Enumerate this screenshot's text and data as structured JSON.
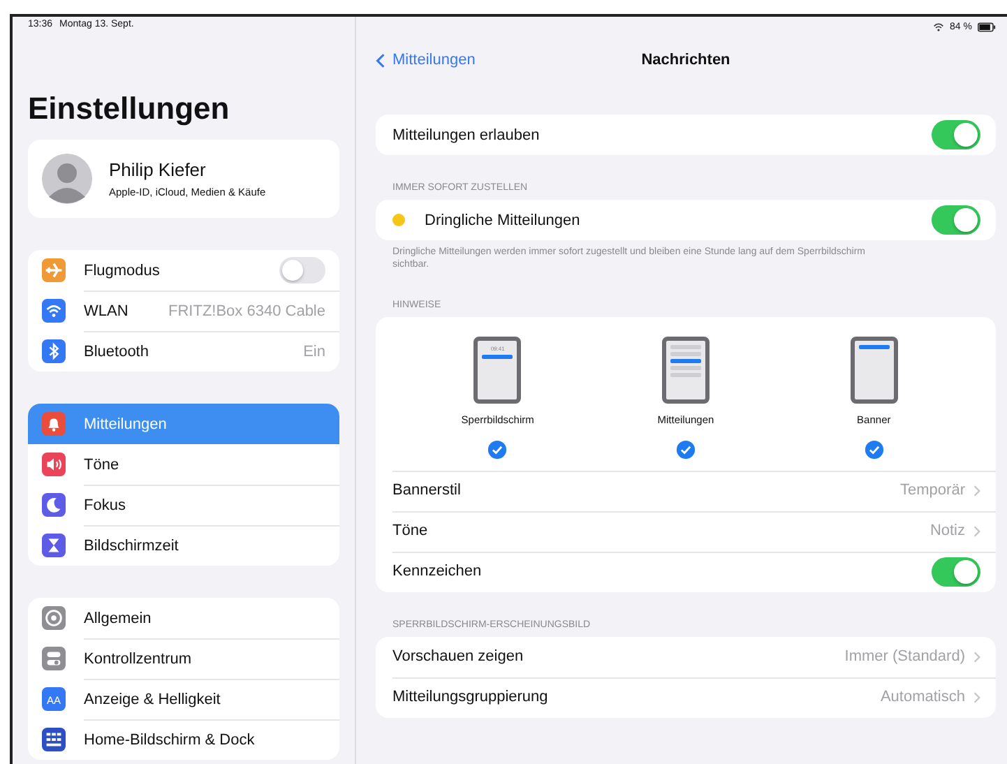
{
  "status_bar": {
    "time": "13:36",
    "date": "Montag 13. Sept.",
    "battery": "84 %"
  },
  "sidebar": {
    "title": "Einstellungen",
    "profile": {
      "name": "Philip Kiefer",
      "subtitle": "Apple-ID, iCloud, Medien & Käufe"
    },
    "groups": [
      {
        "items": [
          {
            "label": "Flugmodus",
            "kind": "toggle",
            "on": false,
            "selected": false,
            "color": "#f09a37"
          },
          {
            "label": "WLAN",
            "kind": "value",
            "value": "FRITZ!Box 6340 Cable",
            "selected": false,
            "color": "#3478f6"
          },
          {
            "label": "Bluetooth",
            "kind": "value",
            "value": "Ein",
            "selected": false,
            "color": "#3478f6"
          }
        ]
      },
      {
        "items": [
          {
            "label": "Mitteilungen",
            "kind": "plain",
            "selected": true,
            "color": "#eb4d3d"
          },
          {
            "label": "Töne",
            "kind": "plain",
            "selected": false,
            "color": "#eb445a"
          },
          {
            "label": "Fokus",
            "kind": "plain",
            "selected": false,
            "color": "#5e5ce6"
          },
          {
            "label": "Bildschirmzeit",
            "kind": "plain",
            "selected": false,
            "color": "#5e5ce6"
          }
        ]
      },
      {
        "items": [
          {
            "label": "Allgemein",
            "kind": "plain",
            "selected": false,
            "color": "#8e8e93"
          },
          {
            "label": "Kontrollzentrum",
            "kind": "plain",
            "selected": false,
            "color": "#8e8e93"
          },
          {
            "label": "Anzeige & Helligkeit",
            "kind": "plain",
            "selected": false,
            "color": "#3478f6",
            "icon_text": "AA"
          },
          {
            "label": "Home-Bildschirm & Dock",
            "kind": "plain",
            "selected": false,
            "color": "#2c4fc2"
          }
        ]
      }
    ]
  },
  "nav": {
    "back": "Mitteilungen",
    "title": "Nachrichten"
  },
  "sections": [
    {
      "rows": [
        {
          "kind": "toggle",
          "label": "Mitteilungen erlauben",
          "on": true
        }
      ]
    },
    {
      "header": "IMMER SOFORT ZUSTELLEN",
      "rows": [
        {
          "kind": "toggle",
          "label": "Dringliche Mitteilungen",
          "on": true,
          "color": "#f5c518"
        }
      ],
      "footer": "Dringliche Mitteilungen werden immer sofort zugestellt und bleiben eine Stunde lang auf dem Sperrbildschirm sichtbar."
    },
    {
      "header": "HINWEISE",
      "styles": [
        {
          "label": "Sperrbildschirm",
          "checked": true,
          "time": "09:41"
        },
        {
          "label": "Mitteilungen",
          "checked": true
        },
        {
          "label": "Banner",
          "checked": true
        }
      ],
      "rows": [
        {
          "kind": "value",
          "label": "Bannerstil",
          "value": "Temporär"
        },
        {
          "kind": "value",
          "label": "Töne",
          "value": "Notiz"
        },
        {
          "kind": "toggle",
          "label": "Kennzeichen",
          "on": true
        }
      ]
    },
    {
      "header": "SPERRBILDSCHIRM-ERSCHEINUNGSBILD",
      "rows": [
        {
          "kind": "value",
          "label": "Vorschauen zeigen",
          "value": "Immer (Standard)"
        },
        {
          "kind": "value",
          "label": "Mitteilungsgruppierung",
          "value": "Automatisch"
        }
      ]
    }
  ]
}
